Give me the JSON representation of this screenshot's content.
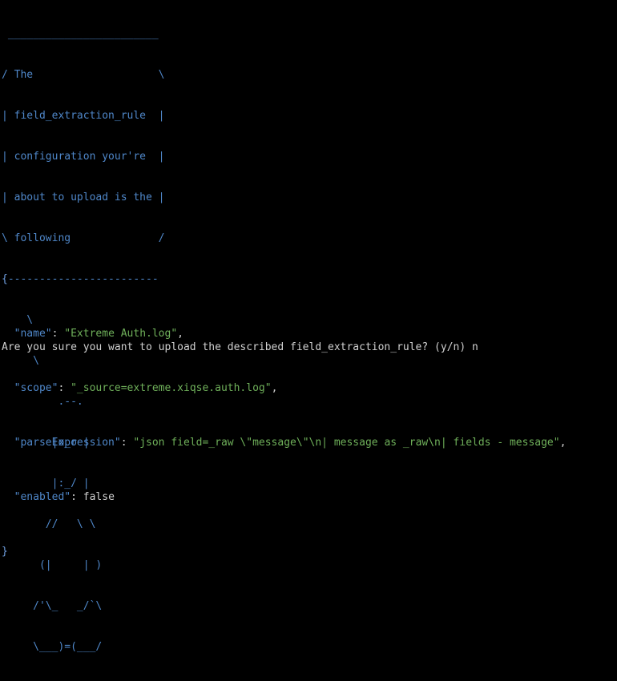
{
  "cowsay": {
    "lines": [
      " ________________________",
      "/ The                    \\",
      "| field_extraction_rule  |",
      "| configuration your're  |",
      "| about to upload is the |",
      "\\ following              /",
      " ------------------------",
      "    \\",
      "     \\",
      "         .--.",
      "        |o_o |",
      "        |:_/ |",
      "       //   \\ \\",
      "      (|     | )",
      "     /'\\_   _/`\\",
      "     \\___)=(___/"
    ]
  },
  "json": {
    "open_brace": "{",
    "close_brace": "}",
    "fields": [
      {
        "key": "\"name\"",
        "sep": ": ",
        "value": "\"Extreme Auth.log\"",
        "suffix": ",",
        "value_type": "string"
      },
      {
        "key": "\"scope\"",
        "sep": ": ",
        "value": "\"_source=extreme.xiqse.auth.log\"",
        "suffix": ",",
        "value_type": "string"
      },
      {
        "key": "\"parseExpression\"",
        "sep": ": ",
        "value": "\"json field=_raw \\\"message\\\"\\n| message as _raw\\n| fields - message\"",
        "suffix": ",",
        "value_type": "string"
      },
      {
        "key": "\"enabled\"",
        "sep": ": ",
        "value": "false",
        "suffix": "",
        "value_type": "literal"
      }
    ]
  },
  "prompt": {
    "text": "Are you sure you want to upload the described field_extraction_rule? (y/n) n"
  },
  "colors": {
    "background": "#000000",
    "ascii_art": "#4f87c9",
    "json_key": "#4f87c9",
    "json_string": "#6fb05a",
    "plain_text": "#d0d0d0"
  }
}
